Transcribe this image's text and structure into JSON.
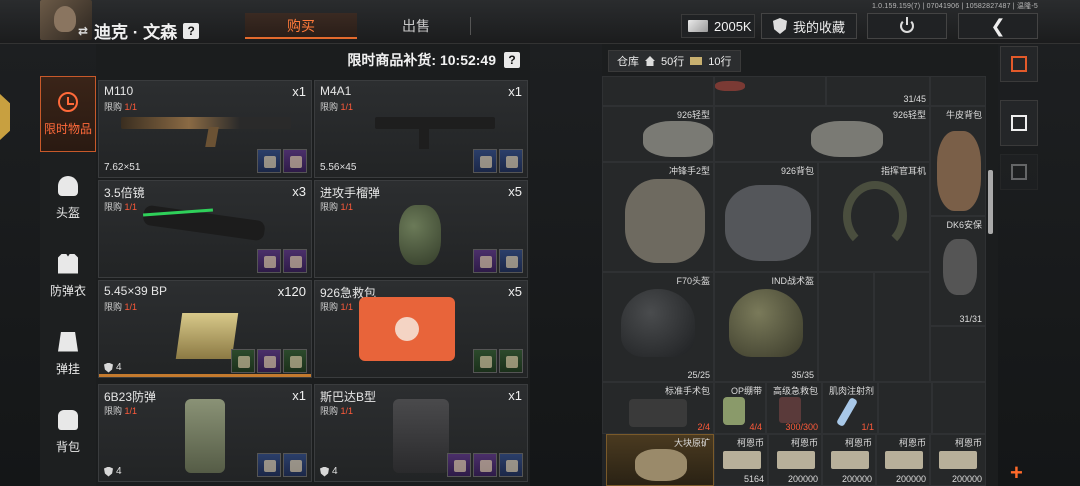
{
  "header": {
    "player_name": "迪克 · 文森",
    "name_prefix": "⇄",
    "help": "?",
    "tabs": [
      {
        "label": "购买",
        "active": true
      },
      {
        "label": "出售",
        "active": false
      }
    ],
    "version": "1.0.159.159(7) | 07041906 | 10582827487 | 温隆-5",
    "money": "2005K",
    "favorites": "我的收藏"
  },
  "sidebar": {
    "items": [
      {
        "label": "限时物品",
        "icon": "clock-icon",
        "active": true
      },
      {
        "label": "头盔",
        "icon": "helmet-icon"
      },
      {
        "label": "防弹衣",
        "icon": "vest-icon"
      },
      {
        "label": "弹挂",
        "icon": "chest-rig-icon"
      },
      {
        "label": "背包",
        "icon": "backpack-icon"
      }
    ]
  },
  "shop": {
    "restock_label": "限时商品补货: 10:52:49",
    "help": "?",
    "limit_prefix": "限购 ",
    "items": [
      {
        "name": "M110",
        "limit": "1/1",
        "qty": "x1",
        "footer": "7.62×51"
      },
      {
        "name": "M4A1",
        "limit": "1/1",
        "qty": "x1",
        "footer": "5.56×45"
      },
      {
        "name": "3.5倍镜",
        "limit": "1/1",
        "qty": "x3",
        "footer": ""
      },
      {
        "name": "进攻手榴弹",
        "limit": "1/1",
        "qty": "x5",
        "footer": ""
      },
      {
        "name": "5.45×39 BP",
        "limit": "1/1",
        "qty": "x120",
        "footer": "4"
      },
      {
        "name": "926急救包",
        "limit": "1/1",
        "qty": "x5",
        "footer": ""
      },
      {
        "name": "6B23防弹",
        "limit": "1/1",
        "qty": "x1",
        "footer": "4"
      },
      {
        "name": "斯巴达B型",
        "limit": "1/1",
        "qty": "x1",
        "footer": "4"
      }
    ]
  },
  "warehouse": {
    "label": "仓库",
    "rows": "50行",
    "cash_rows": "10行",
    "cells": {
      "top_count": "31/45",
      "bag1": "926轻型",
      "bag2": "926轻型",
      "bag3": "牛皮背包",
      "bag4": "冲锋手2型",
      "bag5": "926背包",
      "headset": "指挥官耳机",
      "dk6": "DK6安保",
      "dk6_count": "31/31",
      "helmet1": "F70头盔",
      "helmet1_count": "25/25",
      "helmet2": "IND战术盔",
      "helmet2_count": "35/35",
      "kit": "标准手术包",
      "kit_count": "2/4",
      "bandage": "OP绷带",
      "bandage_count": "4/4",
      "medkit": "高级急救包",
      "medkit_count": "300/300",
      "injector": "肌肉注射剂",
      "injector_count": "1/1",
      "ore": "大块原矿",
      "coins": [
        {
          "name": "柯恩币",
          "count": "5164"
        },
        {
          "name": "柯恩币",
          "count": "200000"
        },
        {
          "name": "柯恩币",
          "count": "200000"
        },
        {
          "name": "柯恩币",
          "count": "200000"
        },
        {
          "name": "柯恩币",
          "count": "200000"
        }
      ]
    }
  },
  "colors": {
    "accent": "#e36a2d",
    "limit_red": "#ff5a3a",
    "bg": "#161819"
  }
}
